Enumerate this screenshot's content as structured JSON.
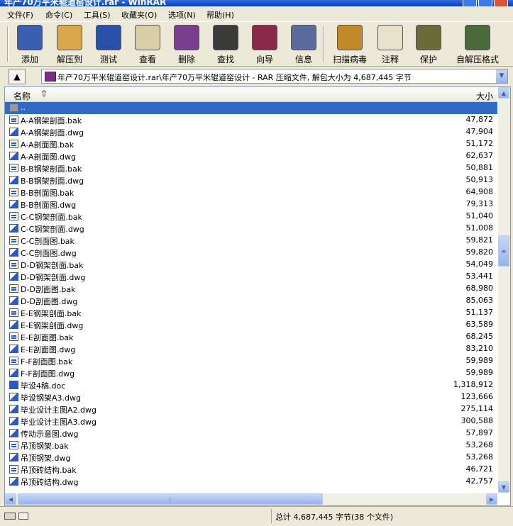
{
  "title": "年产70万平米辊道窑设计.rar - WinRAR",
  "menu": [
    "文件(F)",
    "命令(C)",
    "工具(S)",
    "收藏夹(O)",
    "选项(N)",
    "帮助(H)"
  ],
  "toolbar": [
    {
      "label": "添加",
      "icon": "add-books-icon",
      "color": "#3a5fb0"
    },
    {
      "label": "解压到",
      "icon": "extract-folder-icon",
      "color": "#d8a84a"
    },
    {
      "label": "测试",
      "icon": "test-check-icon",
      "color": "#2a4fa8"
    },
    {
      "label": "查看",
      "icon": "glasses-icon",
      "color": "#d8cfa8"
    },
    {
      "label": "删除",
      "icon": "delete-icon",
      "color": "#7a3e8e"
    },
    {
      "label": "查找",
      "icon": "binoculars-icon",
      "color": "#3a3a3a"
    },
    {
      "label": "向导",
      "icon": "wizard-icon",
      "color": "#8a2a4a"
    },
    {
      "label": "信息",
      "icon": "info-icon",
      "color": "#5a6a9a"
    },
    {
      "label": "扫描病毒",
      "icon": "virus-scan-icon",
      "color": "#c08a2a"
    },
    {
      "label": "注释",
      "icon": "comment-icon",
      "color": "#e8e2cc"
    },
    {
      "label": "保护",
      "icon": "shield-icon",
      "color": "#6a6a3a"
    },
    {
      "label": "自解压格式",
      "icon": "sfx-icon",
      "color": "#4a6a3a"
    }
  ],
  "address": {
    "path": "年产70万平米辊道窑设计.rar\\年产70万平米辊道窑设计 - RAR 压缩文件, 解包大小为 4,687,445 字节"
  },
  "columns": {
    "name": "名称",
    "size": "大小"
  },
  "files": [
    {
      "name": "..",
      "size": "",
      "type": "folder"
    },
    {
      "name": "A-A钢架剖面.bak",
      "size": "47,872",
      "type": "bak"
    },
    {
      "name": "A-A钢架剖面.dwg",
      "size": "47,904",
      "type": "dwg"
    },
    {
      "name": "A-A剖面图.bak",
      "size": "51,172",
      "type": "bak"
    },
    {
      "name": "A-A剖面图.dwg",
      "size": "62,637",
      "type": "dwg"
    },
    {
      "name": "B-B钢架剖面.bak",
      "size": "50,881",
      "type": "bak"
    },
    {
      "name": "B-B钢架剖面.dwg",
      "size": "50,913",
      "type": "dwg"
    },
    {
      "name": "B-B剖面图.bak",
      "size": "64,908",
      "type": "bak"
    },
    {
      "name": "B-B剖面图.dwg",
      "size": "79,313",
      "type": "dwg"
    },
    {
      "name": "C-C钢架剖面.bak",
      "size": "51,040",
      "type": "bak"
    },
    {
      "name": "C-C钢架剖面.dwg",
      "size": "51,008",
      "type": "dwg"
    },
    {
      "name": "C-C剖面图.bak",
      "size": "59,821",
      "type": "bak"
    },
    {
      "name": "C-C剖面图.dwg",
      "size": "59,820",
      "type": "dwg"
    },
    {
      "name": "D-D钢架剖面.bak",
      "size": "54,049",
      "type": "bak"
    },
    {
      "name": "D-D钢架剖面.dwg",
      "size": "53,441",
      "type": "dwg"
    },
    {
      "name": "D-D剖面图.bak",
      "size": "68,980",
      "type": "bak"
    },
    {
      "name": "D-D剖面图.dwg",
      "size": "85,063",
      "type": "dwg"
    },
    {
      "name": "E-E钢架剖面.bak",
      "size": "51,137",
      "type": "bak"
    },
    {
      "name": "E-E钢架剖面.dwg",
      "size": "63,589",
      "type": "dwg"
    },
    {
      "name": "E-E剖面图.bak",
      "size": "68,245",
      "type": "bak"
    },
    {
      "name": "E-E剖面图.dwg",
      "size": "83,210",
      "type": "dwg"
    },
    {
      "name": "F-F剖面图.bak",
      "size": "59,989",
      "type": "bak"
    },
    {
      "name": "F-F剖面图.dwg",
      "size": "59,989",
      "type": "dwg"
    },
    {
      "name": "毕设4稿.doc",
      "size": "1,318,912",
      "type": "doc"
    },
    {
      "name": "毕设钢架A3.dwg",
      "size": "123,666",
      "type": "dwg"
    },
    {
      "name": "毕业设计主图A2.dwg",
      "size": "275,114",
      "type": "dwg"
    },
    {
      "name": "毕业设计主图A3.dwg",
      "size": "300,588",
      "type": "dwg"
    },
    {
      "name": "传动示意图.dwg",
      "size": "57,897",
      "type": "dwg"
    },
    {
      "name": "吊顶钢架.bak",
      "size": "53,268",
      "type": "bak"
    },
    {
      "name": "吊顶钢架.dwg",
      "size": "53,268",
      "type": "dwg"
    },
    {
      "name": "吊顶砖结构.bak",
      "size": "46,721",
      "type": "bak"
    },
    {
      "name": "吊顶砖结构.dwg",
      "size": "42,757",
      "type": "dwg"
    }
  ],
  "status": {
    "total": "总计 4,687,445 字节(38 个文件)"
  }
}
